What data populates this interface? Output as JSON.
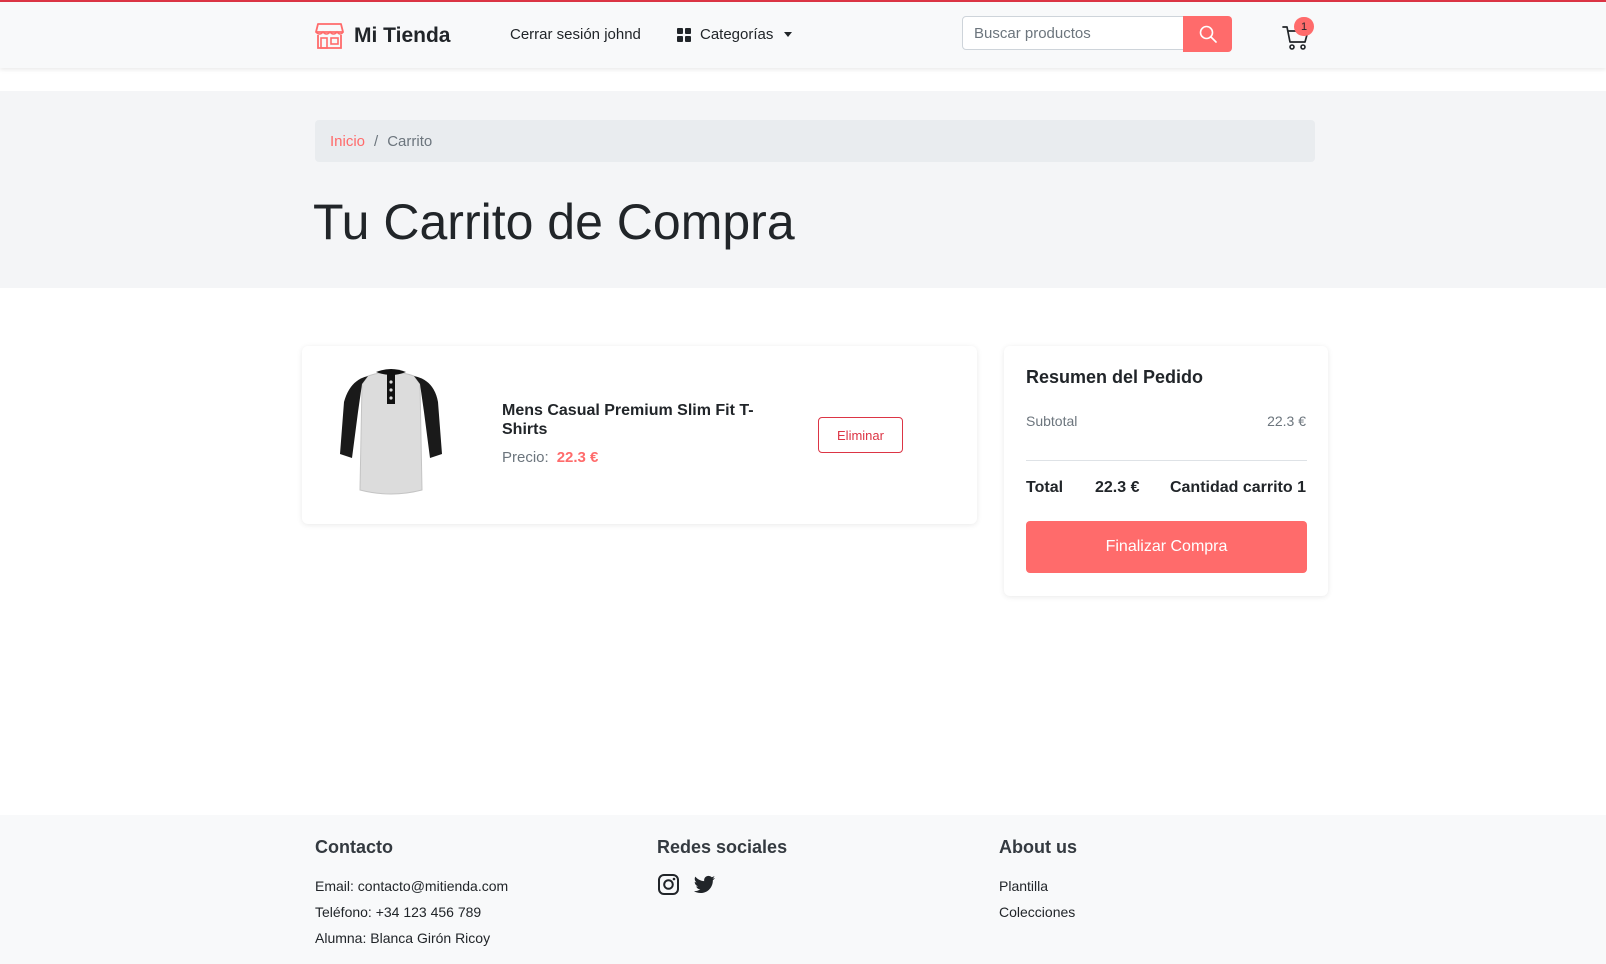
{
  "brand": {
    "name": "Mi Tienda",
    "accent": "#ff6b6b"
  },
  "nav": {
    "logout_label": "Cerrar sesión johnd",
    "categories_label": "Categorías",
    "search_placeholder": "Buscar productos",
    "cart_count": "1"
  },
  "breadcrumb": {
    "home": "Inicio",
    "separator": "/",
    "current": "Carrito"
  },
  "page_title": "Tu Carrito de Compra",
  "cart_items": [
    {
      "title": "Mens Casual Premium Slim Fit T-Shirts",
      "price_label": "Precio:",
      "price": "22.3 €",
      "remove_label": "Eliminar"
    }
  ],
  "summary": {
    "title": "Resumen del Pedido",
    "subtotal_label": "Subtotal",
    "subtotal_value": "22.3 €",
    "total_label": "Total",
    "total_value": "22.3 €",
    "cart_count_label": "Cantidad carrito 1",
    "checkout_label": "Finalizar Compra"
  },
  "footer": {
    "contact": {
      "title": "Contacto",
      "email": "Email: contacto@mitienda.com",
      "phone": "Teléfono: +34 123 456 789",
      "student": "Alumna: Blanca Girón Ricoy"
    },
    "social": {
      "title": "Redes sociales",
      "icons": [
        "instagram-icon",
        "twitter-icon"
      ]
    },
    "about": {
      "title": "About us",
      "links": [
        "Plantilla",
        "Colecciones"
      ]
    }
  }
}
